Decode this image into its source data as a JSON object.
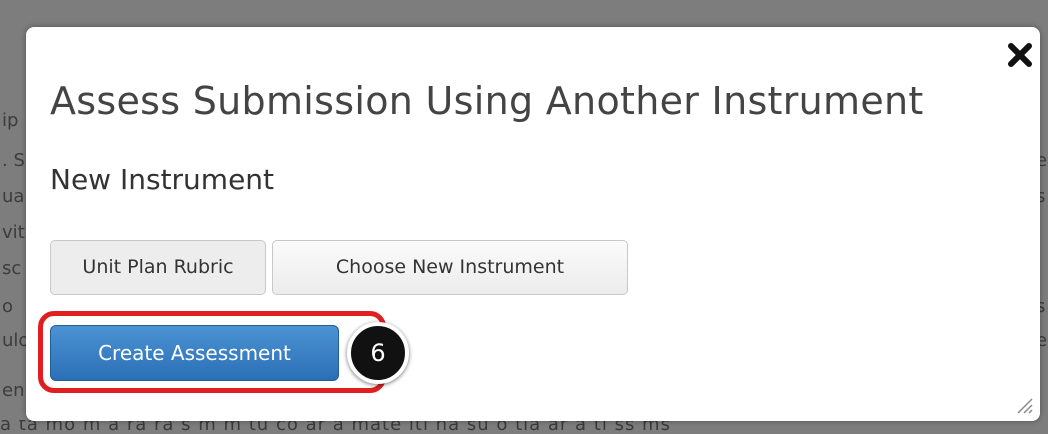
{
  "background": {
    "left_letters": [
      "ip",
      ". S",
      "ua",
      "vit",
      "sc",
      "o",
      "ulo",
      "en"
    ],
    "right_letters": [
      "e",
      "s",
      "s",
      "e"
    ],
    "bottom_text": "a ta mo m a ra ra s m m tu co ar a mate iti ha su o tia ar a ti ss ms"
  },
  "modal": {
    "title": "Assess Submission Using Another Instrument",
    "section_title": "New Instrument",
    "close_icon": "close-x-icon",
    "current_instrument_label": "Unit Plan Rubric",
    "choose_instrument_label": "Choose New Instrument",
    "create_assessment_label": "Create Assessment",
    "close_link_label": "Close",
    "resize_icon": "resize-grip-icon"
  },
  "annotation": {
    "step_number": "6",
    "highlight_color": "#e02020"
  },
  "colors": {
    "primary_button": "#2b6fb5",
    "link": "#1a6fc0",
    "overlay": "#7d7d7d"
  }
}
